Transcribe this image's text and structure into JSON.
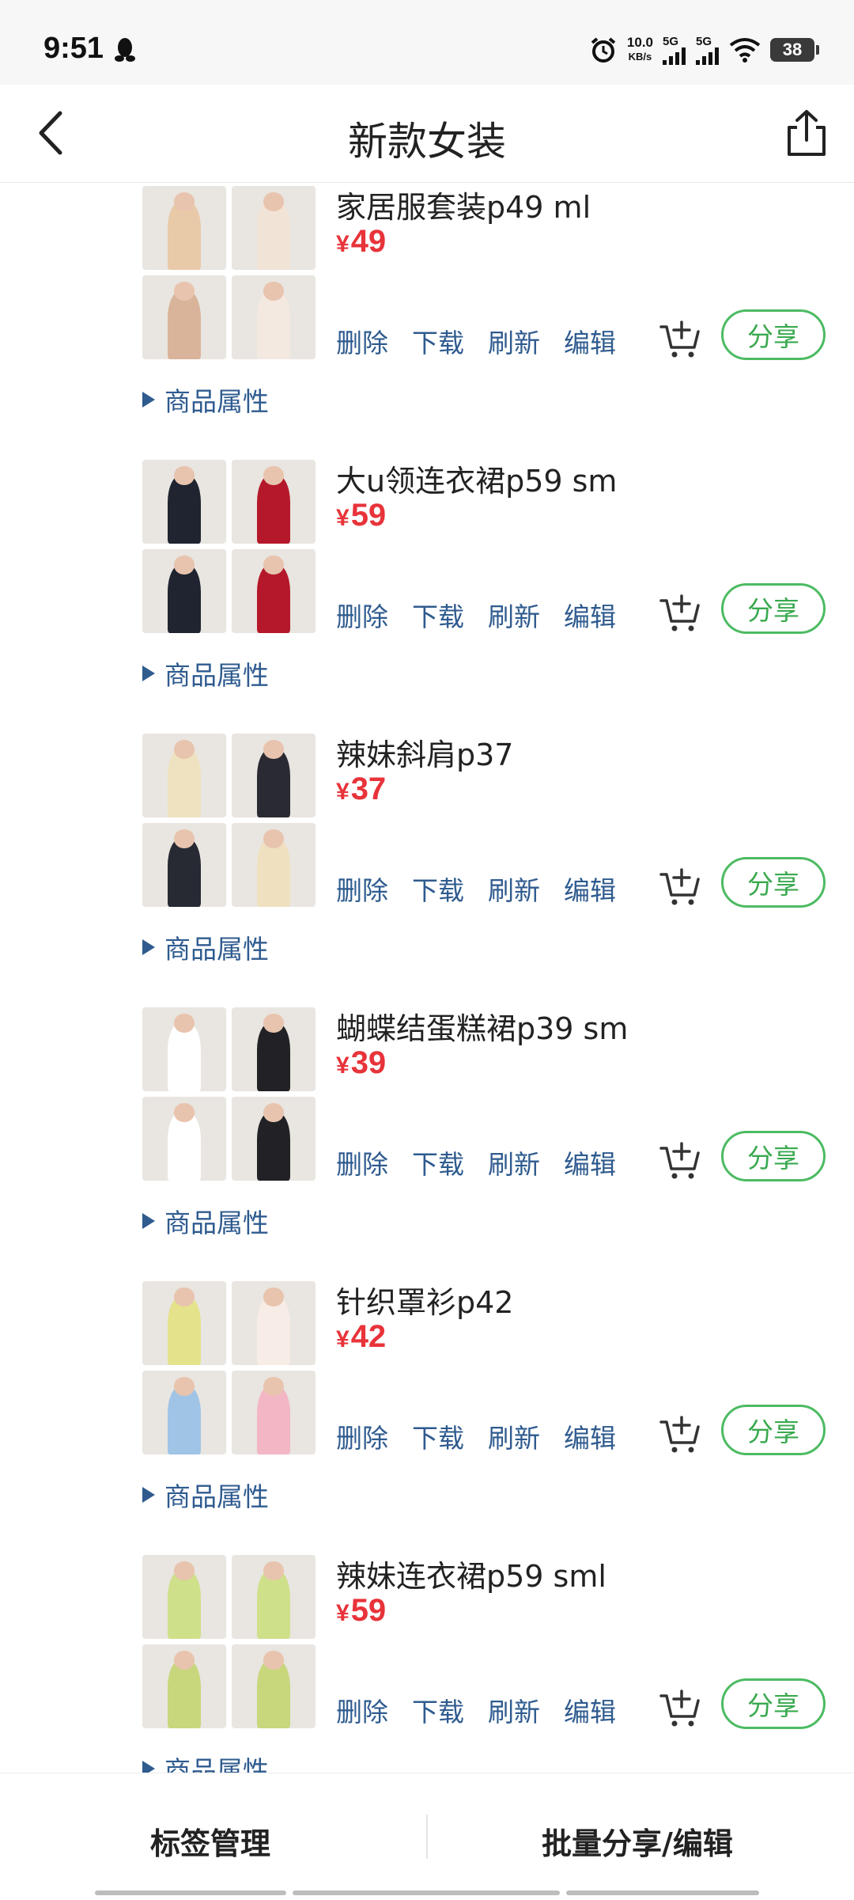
{
  "status_bar": {
    "time": "9:51",
    "net_speed_value": "10.0",
    "net_speed_unit": "KB/s",
    "sig1": "5G",
    "sig2": "5G",
    "battery": "38"
  },
  "header": {
    "title": "新款女装"
  },
  "actions": {
    "delete": "删除",
    "download": "下载",
    "refresh": "刷新",
    "edit": "编辑",
    "share": "分享",
    "attr": "商品属性"
  },
  "items": [
    {
      "title": "家居服套装p49 ml",
      "price": "49",
      "currency": "¥",
      "colors": [
        "#e8c9a8",
        "#f1e3d6",
        "#d9b49a",
        "#f4e9e1"
      ]
    },
    {
      "title": "大u领连衣裙p59 sm",
      "price": "59",
      "currency": "¥",
      "colors": [
        "#1f2430",
        "#b5182a",
        "#1f2430",
        "#b5182a"
      ]
    },
    {
      "title": "辣妹斜肩p37",
      "price": "37",
      "currency": "¥",
      "colors": [
        "#efe2c0",
        "#2a2a32",
        "#272a33",
        "#efe0c0"
      ]
    },
    {
      "title": "蝴蝶结蛋糕裙p39 sm",
      "price": "39",
      "currency": "¥",
      "colors": [
        "#ffffff",
        "#222226",
        "#ffffff",
        "#222226"
      ]
    },
    {
      "title": "针织罩衫p42",
      "price": "42",
      "currency": "¥",
      "colors": [
        "#e4e38c",
        "#f7ede6",
        "#9fc4e6",
        "#f3b6c4"
      ]
    },
    {
      "title": "辣妹连衣裙p59 sml",
      "price": "59",
      "currency": "¥",
      "colors": [
        "#cfe08a",
        "#cfe08a",
        "#c8d77c",
        "#c8d77c"
      ]
    }
  ],
  "bottom_bar": {
    "tag_manage": "标签管理",
    "batch": "批量分享/编辑"
  }
}
